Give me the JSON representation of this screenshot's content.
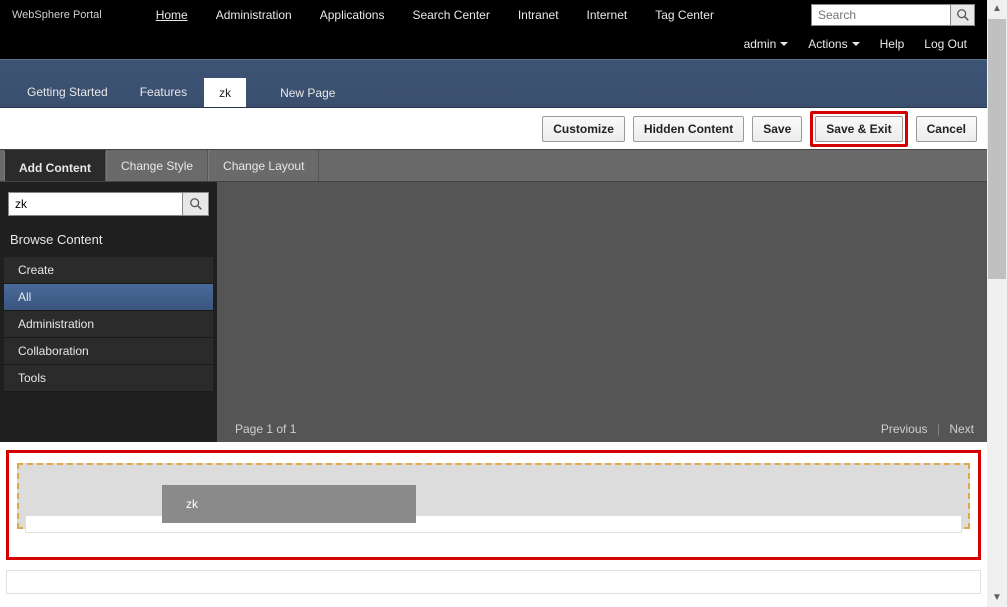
{
  "brand": "WebSphere Portal",
  "topnav": {
    "home": "Home",
    "administration": "Administration",
    "applications": "Applications",
    "search_center": "Search Center",
    "intranet": "Intranet",
    "internet": "Internet",
    "tag_center": "Tag Center"
  },
  "search": {
    "placeholder": "Search"
  },
  "usermenu": {
    "admin": "admin",
    "actions": "Actions",
    "help": "Help",
    "logout": "Log Out"
  },
  "tabs": {
    "getting_started": "Getting Started",
    "features": "Features",
    "zk": "zk",
    "new_page": "New Page"
  },
  "actions": {
    "customize": "Customize",
    "hidden_content": "Hidden Content",
    "save": "Save",
    "save_exit": "Save & Exit",
    "cancel": "Cancel"
  },
  "editor_tabs": {
    "add_content": "Add Content",
    "change_style": "Change Style",
    "change_layout": "Change Layout"
  },
  "sidebar": {
    "search_value": "zk",
    "heading": "Browse Content",
    "items": {
      "create": "Create",
      "all": "All",
      "administration": "Administration",
      "collaboration": "Collaboration",
      "tools": "Tools"
    }
  },
  "pager": {
    "status": "Page 1 of 1",
    "previous": "Previous",
    "next": "Next"
  },
  "drag": {
    "label": "zk"
  }
}
